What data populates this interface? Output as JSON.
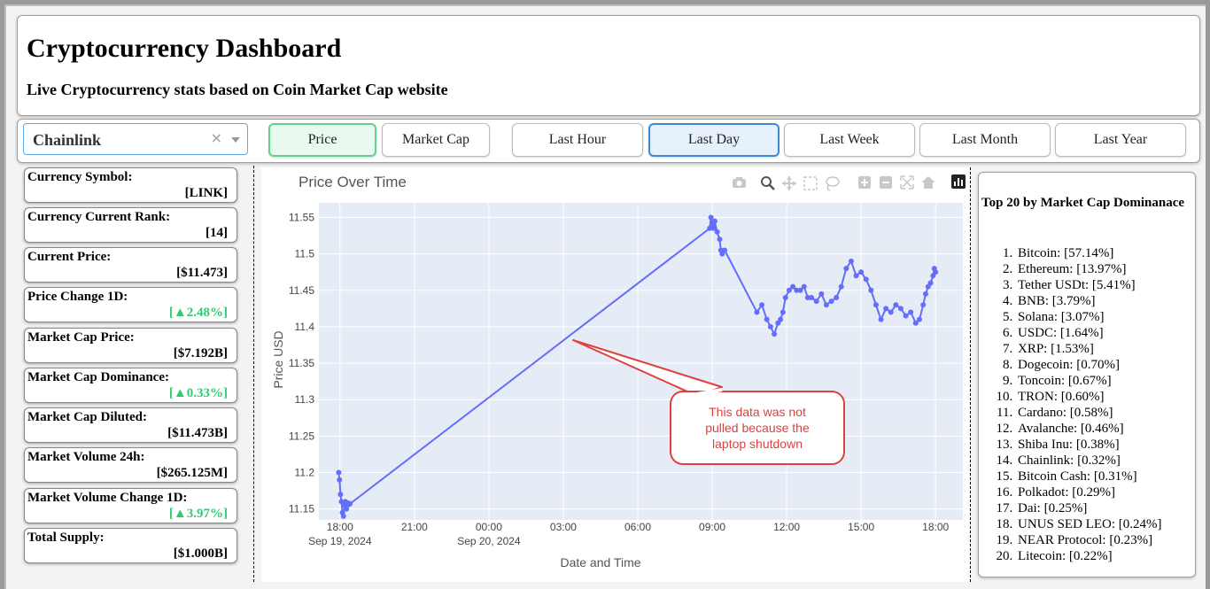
{
  "header": {
    "title": "Cryptocurrency Dashboard",
    "subtitle": "Live Cryptocurrency stats based on Coin Market Cap website"
  },
  "controls": {
    "currency_select": "Chainlink",
    "clear_symbol": "×",
    "metric_buttons": [
      "Price",
      "Market Cap"
    ],
    "range_buttons": [
      "Last Hour",
      "Last Day",
      "Last Week",
      "Last Month",
      "Last Year"
    ],
    "active_metric": "Price",
    "active_range": "Last Day"
  },
  "stats": [
    {
      "label": "Currency Symbol:",
      "value": "[LINK]",
      "color": "black"
    },
    {
      "label": "Currency Current Rank:",
      "value": "[14]",
      "color": "black"
    },
    {
      "label": "Current Price:",
      "value": "[$11.473]",
      "color": "black"
    },
    {
      "label": "Price Change 1D:",
      "value": "[▲2.48%]",
      "color": "green"
    },
    {
      "label": "Market Cap Price:",
      "value": "[$7.192B]",
      "color": "black"
    },
    {
      "label": "Market Cap Dominance:",
      "value": "[▲0.33%]",
      "color": "green"
    },
    {
      "label": "Market Cap Diluted:",
      "value": "[$11.473B]",
      "color": "black"
    },
    {
      "label": "Market Volume 24h:",
      "value": "[$265.125M]",
      "color": "black"
    },
    {
      "label": "Market Volume Change 1D:",
      "value": "[▲3.97%]",
      "color": "green"
    },
    {
      "label": "Total Supply:",
      "value": "[$1.000B]",
      "color": "black"
    }
  ],
  "colors": {
    "series": "#636efa",
    "plot_bg": "#e5ecf6",
    "green": "#2ecc71",
    "callout_border": "#e0403c",
    "callout_text": "#e0403c"
  },
  "chart_data": {
    "type": "line",
    "title": "Price Over Time",
    "xlabel": "Date and Time",
    "ylabel": "Price USD",
    "ylim": [
      11.135,
      11.57
    ],
    "y_ticks": [
      11.15,
      11.2,
      11.25,
      11.3,
      11.35,
      11.4,
      11.45,
      11.5,
      11.55
    ],
    "y_tick_labels": [
      "11.15",
      "11.2",
      "11.25",
      "11.3",
      "11.35",
      "11.4",
      "11.45",
      "11.5",
      "11.55"
    ],
    "x_ticks": [
      {
        "hour": 18,
        "label": "18:00",
        "sublabel": "Sep 19, 2024"
      },
      {
        "hour": 21,
        "label": "21:00",
        "sublabel": ""
      },
      {
        "hour": 24,
        "label": "00:00",
        "sublabel": "Sep 20, 2024"
      },
      {
        "hour": 27,
        "label": "03:00",
        "sublabel": ""
      },
      {
        "hour": 30,
        "label": "06:00",
        "sublabel": ""
      },
      {
        "hour": 33,
        "label": "09:00",
        "sublabel": ""
      },
      {
        "hour": 36,
        "label": "12:00",
        "sublabel": ""
      },
      {
        "hour": 39,
        "label": "15:00",
        "sublabel": ""
      },
      {
        "hour": 42,
        "label": "18:00",
        "sublabel": ""
      }
    ],
    "xlim": [
      17.15,
      43.1
    ],
    "series": [
      {
        "x": [
          17.95,
          17.98,
          18.02,
          18.06,
          18.1,
          18.14,
          18.18,
          18.22,
          18.26,
          18.3,
          18.35,
          18.4,
          32.9,
          32.95,
          33.0,
          33.05,
          33.1,
          33.2,
          33.3,
          33.35,
          33.4,
          33.5,
          34.8,
          35.0,
          35.2,
          35.35,
          35.5,
          35.65,
          35.75,
          35.85,
          35.95,
          36.1,
          36.25,
          36.4,
          36.55,
          36.7,
          36.85,
          37.0,
          37.2,
          37.4,
          37.6,
          37.8,
          38.0,
          38.2,
          38.4,
          38.6,
          38.8,
          39.0,
          39.2,
          39.4,
          39.6,
          39.8,
          40.0,
          40.2,
          40.4,
          40.6,
          40.8,
          41.0,
          41.2,
          41.35,
          41.5,
          41.6,
          41.7,
          41.8,
          41.9,
          41.95,
          42.0
        ],
        "y": [
          11.2,
          11.19,
          11.17,
          11.16,
          11.145,
          11.14,
          11.155,
          11.16,
          11.15,
          11.155,
          11.158,
          11.157,
          11.535,
          11.55,
          11.54,
          11.535,
          11.545,
          11.53,
          11.52,
          11.505,
          11.5,
          11.505,
          11.42,
          11.43,
          11.41,
          11.4,
          11.39,
          11.405,
          11.41,
          11.42,
          11.44,
          11.45,
          11.455,
          11.45,
          11.45,
          11.455,
          11.44,
          11.44,
          11.435,
          11.445,
          11.43,
          11.435,
          11.44,
          11.455,
          11.48,
          11.49,
          11.47,
          11.475,
          11.465,
          11.45,
          11.43,
          11.41,
          11.425,
          11.42,
          11.43,
          11.425,
          11.415,
          11.42,
          11.405,
          11.41,
          11.43,
          11.445,
          11.455,
          11.46,
          11.47,
          11.48,
          11.475
        ]
      }
    ],
    "annotation": "This data was not pulled because the laptop shutdown",
    "annotation_lines": [
      "This data was not",
      "pulled because the",
      "laptop shutdown"
    ]
  },
  "top20": {
    "title": "Top 20 by Market Cap Dominanace",
    "items": [
      "Bitcoin: [57.14%]",
      "Ethereum: [13.97%]",
      "Tether USDt: [5.41%]",
      "BNB: [3.79%]",
      "Solana: [3.07%]",
      "USDC: [1.64%]",
      "XRP: [1.53%]",
      "Dogecoin: [0.70%]",
      "Toncoin: [0.67%]",
      "TRON: [0.60%]",
      "Cardano: [0.58%]",
      "Avalanche: [0.46%]",
      "Shiba Inu: [0.38%]",
      "Chainlink: [0.32%]",
      "Bitcoin Cash: [0.31%]",
      "Polkadot: [0.29%]",
      "Dai: [0.25%]",
      "UNUS SED LEO: [0.24%]",
      "NEAR Protocol: [0.23%]",
      "Litecoin: [0.22%]"
    ]
  },
  "icons": [
    "camera-icon",
    "zoom-icon",
    "pan-icon",
    "box-select-icon",
    "lasso-icon",
    "zoom-in-icon",
    "zoom-out-icon",
    "autoscale-icon",
    "reset-axes-icon",
    "plotly-logo-icon"
  ]
}
